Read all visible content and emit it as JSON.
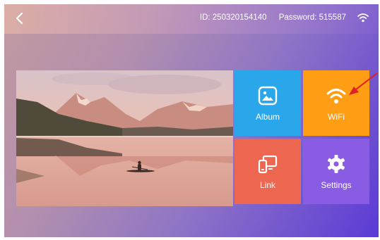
{
  "header": {
    "id_text": "ID: 250320154140",
    "password_text": "Password: 515587",
    "back_icon": "chevron-left-icon",
    "wifi_icon": "wifi-icon"
  },
  "tiles": [
    {
      "label": "Album",
      "icon": "album-icon",
      "color": "#2aa7ea"
    },
    {
      "label": "WiFi",
      "icon": "wifi-icon",
      "color": "#ff9e14"
    },
    {
      "label": "Link",
      "icon": "link-devices-icon",
      "color": "#ec6650"
    },
    {
      "label": "Settings",
      "icon": "gear-icon",
      "color": "#8a5ce4"
    }
  ],
  "annotation": {
    "arrow_color": "#e02020"
  }
}
